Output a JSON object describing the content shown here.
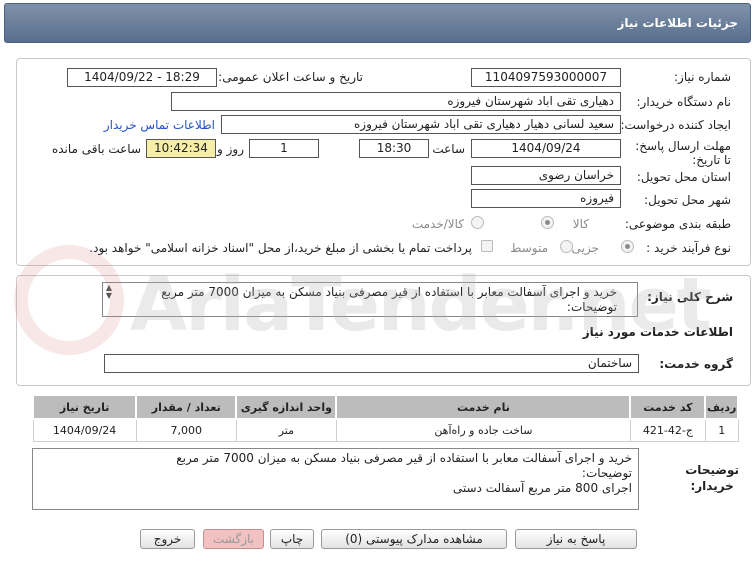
{
  "page": {
    "title": "جزئیات اطلاعات نیاز"
  },
  "form": {
    "need_number_label": "شماره نیاز:",
    "need_number": "1104097593000007",
    "announce_label": "تاریخ و ساعت اعلان عمومی:",
    "announce_value": "1404/09/22 - 18:29",
    "buyer_org_label": "نام دستگاه خریدار:",
    "buyer_org": "دهیاری تقی اباد شهرستان فیروزه",
    "requester_label": "ایجاد کننده درخواست:",
    "requester": "سعید لسانی دهیار دهیاری تقی اباد شهرستان فیروزه",
    "contact_link": "اطلاعات تماس خریدار",
    "deadline_label": "مهلت ارسال پاسخ: تا تاریخ:",
    "deadline_date": "1404/09/24",
    "time_label": "ساعت",
    "deadline_time": "18:30",
    "days_value": "1",
    "days_label": "روز و",
    "remaining_time": "10:42:34",
    "remaining_label": "ساعت باقی مانده",
    "province_label": "استان محل تحویل:",
    "province": "خراسان رضوی",
    "city_label": "شهر محل تحویل:",
    "city": "فیروزه",
    "category_label": "طبقه بندی موضوعی:",
    "category_options": [
      "کالا",
      "کالا/خدمت"
    ],
    "process_label": "نوع فرآیند خرید :",
    "process_options": [
      "جزیی",
      "متوسط"
    ],
    "payment_note": "پرداخت تمام یا بخشی از مبلغ خرید،از محل \"اسناد خزانه اسلامی\" خواهد بود."
  },
  "summary": {
    "label": "شرح کلی نیاز:",
    "text_line1": "خرید و اجرای آسفالت معابر با استفاده از قیر مصرفی بنیاد مسکن به میزان 7000 متر مربع",
    "text_line2": "توضیحات:"
  },
  "services": {
    "section_title": "اطلاعات خدمات مورد نیاز",
    "group_label": "گروه خدمت:",
    "group_value": "ساختمان",
    "columns": [
      "ردیف",
      "کد خدمت",
      "نام خدمت",
      "واحد اندازه گیری",
      "تعداد / مقدار",
      "تاریخ نیاز"
    ],
    "rows": [
      {
        "row": "1",
        "code": "ج-42-421",
        "name": "ساخت جاده و راه‌آهن",
        "unit": "متر",
        "qty": "7,000",
        "date": "1404/09/24"
      }
    ]
  },
  "buyer_notes": {
    "label_line1": "توضیحات",
    "label_line2": "خریدار:",
    "line1": "خرید و اجرای آسفالت معابر با استفاده از قیر مصرفی بنیاد مسکن به میزان 7000 متر مربع",
    "line2": "توضیحات:",
    "line3": "اجرای 800 متر مربع آسفالت دستی"
  },
  "buttons": {
    "reply": "پاسخ به نیاز",
    "docs": "مشاهده مدارک پیوستی (0)",
    "print": "چاپ",
    "back": "بازگشت",
    "exit": "خروج"
  },
  "watermark": {
    "text": "AriaTender.net"
  }
}
